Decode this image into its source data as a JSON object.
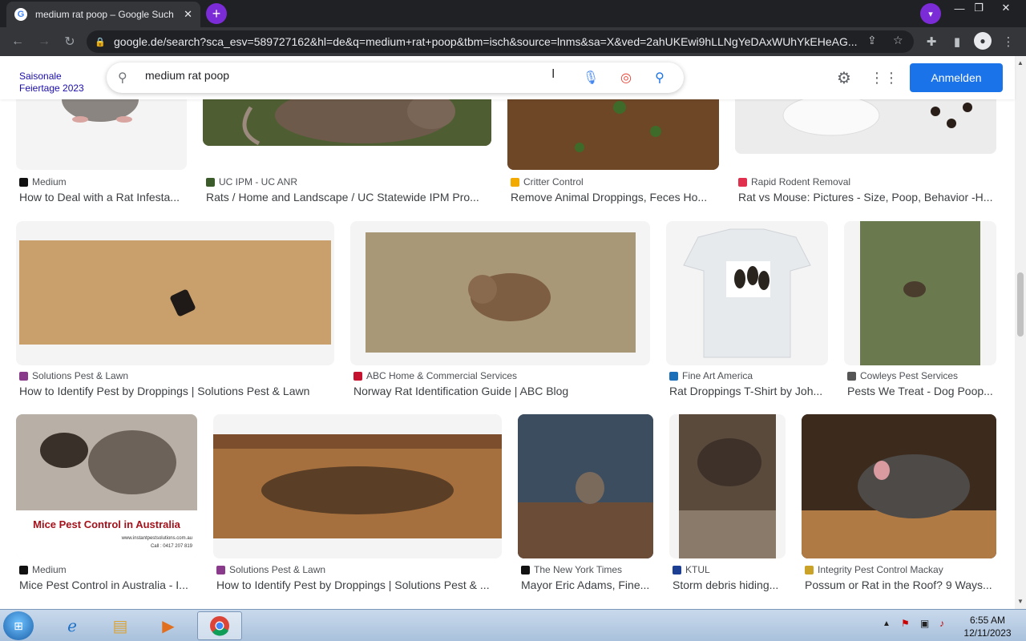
{
  "browser": {
    "tab_title": "medium rat poop – Google Such",
    "tab_favicon": "G",
    "new_tab": "+",
    "tab_close": "✕",
    "url": "google.de/search?sca_esv=589727162&hl=de&q=medium+rat+poop&tbm=isch&source=lnms&sa=X&ved=2ahUKEwi9hLLNgYeDAxWUhYkEHeAG...",
    "win_min": "—",
    "win_restore": "❐",
    "win_close": "✕"
  },
  "google": {
    "doodle_alt": "Saisonale Feiertage 2023",
    "query": "medium rat poop",
    "signin": "Anmelden"
  },
  "results": [
    {
      "source": "Medium",
      "title": "How to Deal with a Rat Infesta...",
      "fav": "#111111"
    },
    {
      "source": "UC IPM - UC ANR",
      "title": "Rats / Home and Landscape / UC Statewide IPM Pro...",
      "fav": "#3b5b2a"
    },
    {
      "source": "Critter Control",
      "title": "Remove Animal Droppings, Feces Ho...",
      "fav": "#f2a900"
    },
    {
      "source": "Rapid Rodent Removal",
      "title": "Rat vs Mouse: Pictures - Size, Poop, Behavior -H...",
      "fav": "#e0304e"
    },
    {
      "source": "Solutions Pest & Lawn",
      "title": "How to Identify Pest by Droppings | Solutions Pest & Lawn",
      "fav": "#8a3a8a"
    },
    {
      "source": "ABC Home & Commercial Services",
      "title": "Norway Rat Identification Guide | ABC Blog",
      "fav": "#c4122f"
    },
    {
      "source": "Fine Art America",
      "title": "Rat Droppings T-Shirt by Joh...",
      "fav": "#1b6fb8"
    },
    {
      "source": "Cowleys Pest Services",
      "title": "Pests We Treat - Dog Poop...",
      "fav": "#555555"
    },
    {
      "source": "Medium",
      "title": "Mice Pest Control in Australia - I...",
      "fav": "#111111"
    },
    {
      "source": "Solutions Pest & Lawn",
      "title": "How to Identify Pest by Droppings | Solutions Pest & ...",
      "fav": "#8a3a8a"
    },
    {
      "source": "The New York Times",
      "title": "Mayor Eric Adams, Fine...",
      "fav": "#111111"
    },
    {
      "source": "KTUL",
      "title": "Storm debris hiding...",
      "fav": "#1c3f94"
    },
    {
      "source": "Integrity Pest Control Mackay",
      "title": "Possum or Rat in the Roof? 9 Ways...",
      "fav": "#c9a227"
    }
  ],
  "ad_text": {
    "headline": "Mice Pest Control in Australia",
    "site": "www.instantpestsolutions.com.au",
    "phone": "Call : 0417 207 819"
  },
  "taskbar": {
    "time": "6:55 AM",
    "date": "12/11/2023"
  }
}
